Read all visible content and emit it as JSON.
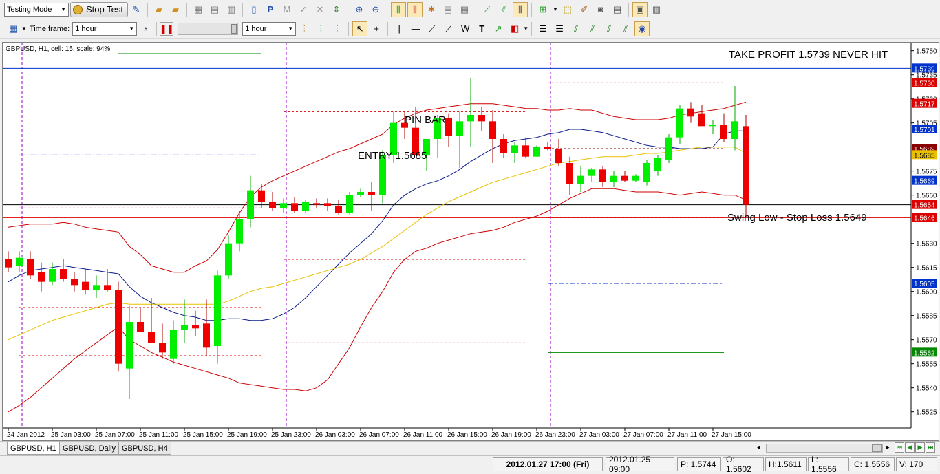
{
  "toolbar": {
    "mode_select": "Testing Mode",
    "stop_test_label": "Stop Test",
    "timeframe_label": "Time frame:",
    "timeframe_value": "1 hour",
    "speed_timeframe_value": "1 hour"
  },
  "chart": {
    "info_label": "GBPUSD, H1, cell: 15, scale: 94%",
    "annotations": {
      "take_profit": "TAKE PROFIT 1.5739 NEVER HIT",
      "pin_bar": "PIN BAR",
      "entry": "ENTRY 1.5685",
      "stop_loss": "Swing Low - Stop Loss 1.5649"
    },
    "price_axis": {
      "ticks": [
        "1.5750",
        "1.5735",
        "1.5720",
        "1.5705",
        "1.5690",
        "1.5675",
        "1.5660",
        "1.5645",
        "1.5630",
        "1.5615",
        "1.5600",
        "1.5585",
        "1.5570",
        "1.5555",
        "1.5540",
        "1.5525"
      ],
      "markers": [
        {
          "value": "1.5739",
          "color": "#0033cc"
        },
        {
          "value": "1.5730",
          "color": "#dd0000"
        },
        {
          "value": "1.5717",
          "color": "#dd0000"
        },
        {
          "value": "1.5701",
          "color": "#0033cc"
        },
        {
          "value": "1.5689",
          "color": "#880000"
        },
        {
          "value": "1.5685",
          "color": "#e8c000"
        },
        {
          "value": "1.5669",
          "color": "#0033cc"
        },
        {
          "value": "1.5654",
          "color": "#dd0000"
        },
        {
          "value": "1.5646",
          "color": "#dd0000"
        },
        {
          "value": "1.5605",
          "color": "#0033cc"
        },
        {
          "value": "1.5562",
          "color": "#008800"
        }
      ]
    },
    "time_axis": [
      "24 Jan 2012",
      "25 Jan 03:00",
      "25 Jan 07:00",
      "25 Jan 11:00",
      "25 Jan 15:00",
      "25 Jan 19:00",
      "25 Jan 23:00",
      "26 Jan 03:00",
      "26 Jan 07:00",
      "26 Jan 11:00",
      "26 Jan 15:00",
      "26 Jan 19:00",
      "26 Jan 23:00",
      "27 Jan 03:00",
      "27 Jan 07:00",
      "27 Jan 11:00",
      "27 Jan 15:00"
    ],
    "colors": {
      "bull": "#00ee00",
      "bear": "#ee0000",
      "band_outer": "#cc0000",
      "band_mid": "#0a1a8c",
      "ma": "#e8c000",
      "grid_v": "#9900cc"
    }
  },
  "chart_data": {
    "type": "candlestick",
    "symbol": "GBPUSD",
    "timeframe": "H1",
    "ylim": [
      1.5515,
      1.5755
    ],
    "candles": [
      {
        "o": 1.562,
        "h": 1.5625,
        "l": 1.5612,
        "c": 1.5615
      },
      {
        "o": 1.5616,
        "h": 1.5625,
        "l": 1.5612,
        "c": 1.5621
      },
      {
        "o": 1.562,
        "h": 1.5625,
        "l": 1.5608,
        "c": 1.561
      },
      {
        "o": 1.5612,
        "h": 1.5618,
        "l": 1.56,
        "c": 1.5606
      },
      {
        "o": 1.5606,
        "h": 1.5618,
        "l": 1.5604,
        "c": 1.5614
      },
      {
        "o": 1.5614,
        "h": 1.562,
        "l": 1.5606,
        "c": 1.5608
      },
      {
        "o": 1.5608,
        "h": 1.5612,
        "l": 1.56,
        "c": 1.5604
      },
      {
        "o": 1.5606,
        "h": 1.5614,
        "l": 1.5598,
        "c": 1.5601
      },
      {
        "o": 1.5601,
        "h": 1.561,
        "l": 1.5596,
        "c": 1.5604
      },
      {
        "o": 1.5604,
        "h": 1.5614,
        "l": 1.56,
        "c": 1.5601
      },
      {
        "o": 1.5601,
        "h": 1.5606,
        "l": 1.555,
        "c": 1.5555
      },
      {
        "o": 1.5552,
        "h": 1.5591,
        "l": 1.5533,
        "c": 1.5581
      },
      {
        "o": 1.5581,
        "h": 1.559,
        "l": 1.5576,
        "c": 1.5575
      },
      {
        "o": 1.5575,
        "h": 1.5596,
        "l": 1.557,
        "c": 1.5568
      },
      {
        "o": 1.5568,
        "h": 1.558,
        "l": 1.5558,
        "c": 1.5562
      },
      {
        "o": 1.5558,
        "h": 1.5582,
        "l": 1.5555,
        "c": 1.5576
      },
      {
        "o": 1.5576,
        "h": 1.5595,
        "l": 1.5568,
        "c": 1.5579
      },
      {
        "o": 1.5579,
        "h": 1.5588,
        "l": 1.5572,
        "c": 1.5577
      },
      {
        "o": 1.558,
        "h": 1.5595,
        "l": 1.556,
        "c": 1.5565
      },
      {
        "o": 1.5566,
        "h": 1.5613,
        "l": 1.5555,
        "c": 1.561
      },
      {
        "o": 1.561,
        "h": 1.5635,
        "l": 1.5608,
        "c": 1.563
      },
      {
        "o": 1.563,
        "h": 1.565,
        "l": 1.5625,
        "c": 1.5645
      },
      {
        "o": 1.5645,
        "h": 1.5672,
        "l": 1.564,
        "c": 1.5663
      },
      {
        "o": 1.5663,
        "h": 1.5667,
        "l": 1.5652,
        "c": 1.5656
      },
      {
        "o": 1.5656,
        "h": 1.5662,
        "l": 1.565,
        "c": 1.5652
      },
      {
        "o": 1.5652,
        "h": 1.5658,
        "l": 1.5649,
        "c": 1.5655
      },
      {
        "o": 1.5655,
        "h": 1.5659,
        "l": 1.5649,
        "c": 1.565
      },
      {
        "o": 1.565,
        "h": 1.5657,
        "l": 1.5649,
        "c": 1.5656
      },
      {
        "o": 1.5655,
        "h": 1.5658,
        "l": 1.5652,
        "c": 1.5654
      },
      {
        "o": 1.5655,
        "h": 1.5658,
        "l": 1.565,
        "c": 1.5653
      },
      {
        "o": 1.5653,
        "h": 1.5657,
        "l": 1.5648,
        "c": 1.5649
      },
      {
        "o": 1.5649,
        "h": 1.5662,
        "l": 1.5648,
        "c": 1.566
      },
      {
        "o": 1.566,
        "h": 1.5664,
        "l": 1.5659,
        "c": 1.5662
      },
      {
        "o": 1.5662,
        "h": 1.5668,
        "l": 1.565,
        "c": 1.566
      },
      {
        "o": 1.566,
        "h": 1.5688,
        "l": 1.5655,
        "c": 1.5685
      },
      {
        "o": 1.5685,
        "h": 1.5712,
        "l": 1.568,
        "c": 1.5705
      },
      {
        "o": 1.5705,
        "h": 1.5712,
        "l": 1.5695,
        "c": 1.5702
      },
      {
        "o": 1.5702,
        "h": 1.5715,
        "l": 1.569,
        "c": 1.5685
      },
      {
        "o": 1.5685,
        "h": 1.5695,
        "l": 1.5675,
        "c": 1.5695
      },
      {
        "o": 1.5695,
        "h": 1.571,
        "l": 1.5683,
        "c": 1.5708
      },
      {
        "o": 1.5708,
        "h": 1.5711,
        "l": 1.569,
        "c": 1.5697
      },
      {
        "o": 1.5697,
        "h": 1.5712,
        "l": 1.5677,
        "c": 1.5706
      },
      {
        "o": 1.5706,
        "h": 1.5733,
        "l": 1.569,
        "c": 1.571
      },
      {
        "o": 1.571,
        "h": 1.5715,
        "l": 1.57,
        "c": 1.5706
      },
      {
        "o": 1.5706,
        "h": 1.5713,
        "l": 1.568,
        "c": 1.5695
      },
      {
        "o": 1.5695,
        "h": 1.5698,
        "l": 1.5683,
        "c": 1.5686
      },
      {
        "o": 1.5686,
        "h": 1.5693,
        "l": 1.568,
        "c": 1.5691
      },
      {
        "o": 1.5691,
        "h": 1.5696,
        "l": 1.5683,
        "c": 1.5684
      },
      {
        "o": 1.5684,
        "h": 1.5691,
        "l": 1.5684,
        "c": 1.569
      },
      {
        "o": 1.569,
        "h": 1.5693,
        "l": 1.5688,
        "c": 1.5689
      },
      {
        "o": 1.5689,
        "h": 1.5695,
        "l": 1.5678,
        "c": 1.568
      },
      {
        "o": 1.568,
        "h": 1.5684,
        "l": 1.566,
        "c": 1.5667
      },
      {
        "o": 1.5667,
        "h": 1.5678,
        "l": 1.5662,
        "c": 1.5672
      },
      {
        "o": 1.5672,
        "h": 1.5677,
        "l": 1.5668,
        "c": 1.5676
      },
      {
        "o": 1.5676,
        "h": 1.5678,
        "l": 1.5665,
        "c": 1.5668
      },
      {
        "o": 1.5668,
        "h": 1.5675,
        "l": 1.5665,
        "c": 1.5672
      },
      {
        "o": 1.5672,
        "h": 1.5675,
        "l": 1.5668,
        "c": 1.5669
      },
      {
        "o": 1.5669,
        "h": 1.5673,
        "l": 1.5668,
        "c": 1.5672
      },
      {
        "o": 1.5668,
        "h": 1.5682,
        "l": 1.5666,
        "c": 1.568
      },
      {
        "o": 1.5675,
        "h": 1.5685,
        "l": 1.5672,
        "c": 1.5683
      },
      {
        "o": 1.5682,
        "h": 1.5698,
        "l": 1.568,
        "c": 1.5696
      },
      {
        "o": 1.5696,
        "h": 1.5716,
        "l": 1.5692,
        "c": 1.5714
      },
      {
        "o": 1.5714,
        "h": 1.5718,
        "l": 1.5705,
        "c": 1.5709
      },
      {
        "o": 1.5711,
        "h": 1.5716,
        "l": 1.5704,
        "c": 1.5703
      },
      {
        "o": 1.5703,
        "h": 1.5707,
        "l": 1.5698,
        "c": 1.5704
      },
      {
        "o": 1.5704,
        "h": 1.5711,
        "l": 1.5693,
        "c": 1.5695
      },
      {
        "o": 1.5695,
        "h": 1.5728,
        "l": 1.5688,
        "c": 1.5706
      },
      {
        "o": 1.5703,
        "h": 1.571,
        "l": 1.5646,
        "c": 1.5654
      }
    ],
    "bands": {
      "upper": [
        1.564,
        1.5641,
        1.5642,
        1.5642,
        1.5642,
        1.5643,
        1.5642,
        1.564,
        1.5639,
        1.5638,
        1.5637,
        1.5628,
        1.5623,
        1.5616,
        1.5614,
        1.5612,
        1.5612,
        1.5616,
        1.5619,
        1.5626,
        1.5637,
        1.5649,
        1.5659,
        1.5665,
        1.5669,
        1.5672,
        1.5675,
        1.5678,
        1.5681,
        1.5684,
        1.5687,
        1.5689,
        1.5692,
        1.5695,
        1.5698,
        1.5704,
        1.5708,
        1.5711,
        1.5713,
        1.5714,
        1.5715,
        1.5716,
        1.5717,
        1.5717,
        1.5717,
        1.5716,
        1.5715,
        1.5714,
        1.5714,
        1.5713,
        1.5713,
        1.5714,
        1.5713,
        1.5713,
        1.5711,
        1.5709,
        1.5708,
        1.5707,
        1.5707,
        1.5707,
        1.5708,
        1.571,
        1.5711,
        1.5712,
        1.5713,
        1.5714,
        1.5716,
        1.5718
      ],
      "middle": [
        1.5606,
        1.561,
        1.5613,
        1.5614,
        1.5615,
        1.5616,
        1.5615,
        1.5614,
        1.5613,
        1.5612,
        1.5611,
        1.5603,
        1.5597,
        1.5593,
        1.559,
        1.5587,
        1.5585,
        1.5584,
        1.5582,
        1.5582,
        1.5583,
        1.5583,
        1.5582,
        1.5582,
        1.5583,
        1.5586,
        1.559,
        1.5596,
        1.5603,
        1.561,
        1.5617,
        1.5624,
        1.563,
        1.5636,
        1.5644,
        1.5654,
        1.566,
        1.5664,
        1.5667,
        1.5669,
        1.5672,
        1.5676,
        1.5681,
        1.5685,
        1.5689,
        1.5692,
        1.5694,
        1.5695,
        1.5696,
        1.5698,
        1.5699,
        1.5701,
        1.5701,
        1.57,
        1.5699,
        1.5697,
        1.5695,
        1.5693,
        1.5691,
        1.569,
        1.569,
        1.5689,
        1.5689,
        1.5689,
        1.569,
        1.5698,
        1.57,
        1.57
      ],
      "lower": [
        1.5525,
        1.5529,
        1.5534,
        1.554,
        1.5546,
        1.5552,
        1.5558,
        1.5563,
        1.5568,
        1.5573,
        1.5578,
        1.557,
        1.5566,
        1.5562,
        1.5559,
        1.5556,
        1.5554,
        1.5552,
        1.555,
        1.5548,
        1.5546,
        1.5543,
        1.5542,
        1.5541,
        1.554,
        1.5539,
        1.5539,
        1.5538,
        1.554,
        1.5545,
        1.5555,
        1.5565,
        1.5578,
        1.559,
        1.56,
        1.5612,
        1.562,
        1.5625,
        1.5627,
        1.563,
        1.5632,
        1.5634,
        1.5636,
        1.5637,
        1.5638,
        1.564,
        1.5643,
        1.5645,
        1.5647,
        1.565,
        1.5654,
        1.5658,
        1.5661,
        1.5664,
        1.5664,
        1.5664,
        1.5663,
        1.5662,
        1.5662,
        1.5662,
        1.5661,
        1.566,
        1.5661,
        1.5662,
        1.5661,
        1.566,
        1.566,
        1.5657
      ]
    },
    "ma": [
      1.557,
      1.5573,
      1.5576,
      1.5579,
      1.5582,
      1.5584,
      1.5586,
      1.5588,
      1.559,
      1.5592,
      1.5593,
      1.5592,
      1.5592,
      1.5592,
      1.5592,
      1.5592,
      1.5592,
      1.5592,
      1.5592,
      1.5592,
      1.5594,
      1.5597,
      1.56,
      1.5602,
      1.5603,
      1.5605,
      1.5607,
      1.5609,
      1.5611,
      1.5613,
      1.5615,
      1.5617,
      1.562,
      1.5624,
      1.5628,
      1.5633,
      1.5638,
      1.5643,
      1.5648,
      1.5652,
      1.5656,
      1.5659,
      1.5662,
      1.5665,
      1.5668,
      1.567,
      1.5672,
      1.5674,
      1.5676,
      1.5678,
      1.568,
      1.5681,
      1.5682,
      1.5683,
      1.5684,
      1.5684,
      1.5684,
      1.5685,
      1.5686,
      1.5686,
      1.5687,
      1.5688,
      1.5689,
      1.569,
      1.569,
      1.569,
      1.569,
      1.5686
    ],
    "levels": [
      {
        "price": 1.5739,
        "style": "solid",
        "color": "#0033cc",
        "from": 0,
        "to": 67
      },
      {
        "price": 1.5654,
        "style": "solid",
        "color": "#000000",
        "from": 0,
        "to": 67
      },
      {
        "price": 1.5646,
        "style": "solid",
        "color": "#dd0000",
        "from": 0,
        "to": 67
      },
      {
        "price": 1.573,
        "style": "dot",
        "color": "#dd0000",
        "from": 49,
        "to": 65
      },
      {
        "price": 1.5689,
        "style": "dot",
        "color": "#880000",
        "from": 49,
        "to": 65
      },
      {
        "price": 1.5646,
        "style": "dot",
        "color": "#dd0000",
        "from": 49,
        "to": 65
      },
      {
        "price": 1.5605,
        "style": "dashdot",
        "color": "#0033cc",
        "from": 49,
        "to": 65
      },
      {
        "price": 1.5562,
        "style": "solid",
        "color": "#008800",
        "from": 49,
        "to": 65
      },
      {
        "price": 1.5712,
        "style": "dot",
        "color": "#dd0000",
        "from": 25,
        "to": 47
      },
      {
        "price": 1.562,
        "style": "dot",
        "color": "#dd0000",
        "from": 25,
        "to": 47
      },
      {
        "price": 1.5568,
        "style": "dot",
        "color": "#dd0000",
        "from": 25,
        "to": 47
      },
      {
        "price": 1.5685,
        "style": "dashdot",
        "color": "#0033cc",
        "from": 1,
        "to": 23
      },
      {
        "price": 1.5652,
        "style": "dot",
        "color": "#dd0000",
        "from": 1,
        "to": 23
      },
      {
        "price": 1.559,
        "style": "dot",
        "color": "#dd0000",
        "from": 1,
        "to": 23
      },
      {
        "price": 1.556,
        "style": "dot",
        "color": "#dd0000",
        "from": 1,
        "to": 23
      }
    ],
    "vlines": [
      1,
      25,
      49
    ]
  },
  "tabs": [
    "GBPUSD, H1",
    "GBPUSD, Daily",
    "GBPUSD, H4"
  ],
  "status": {
    "datetime": "2012.01.27 17:00 (Fri)",
    "cursor_time": "2012.01.25 09:00",
    "p": "P: 1.5744",
    "o": "O: 1.5602",
    "h": "H:1.5611",
    "l": "L: 1.5556",
    "c": "C: 1.5556",
    "v": "V: 170"
  }
}
